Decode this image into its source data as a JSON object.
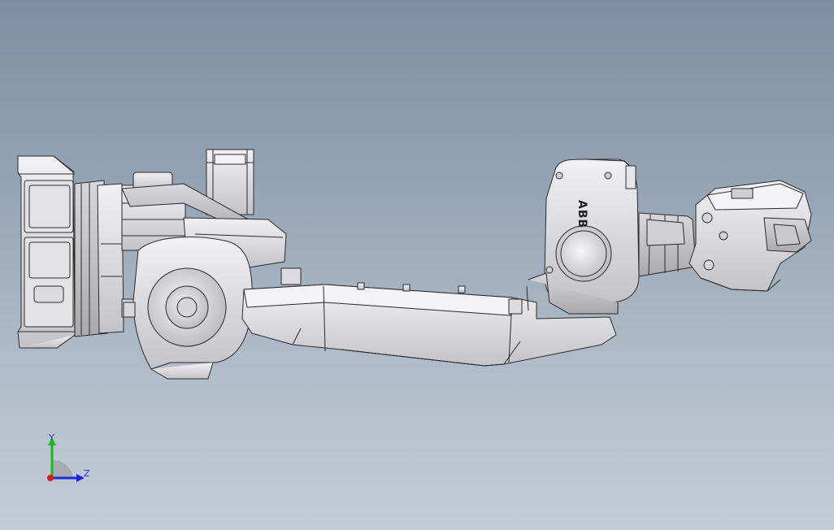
{
  "model": {
    "brand_text": "ABB",
    "colors": {
      "background_top": "#7e8fa3",
      "background_bottom": "#c4ccd6",
      "part_fill": "#e6e6e9",
      "part_shade": "#bdbdc2",
      "edge": "#2b2b2b"
    }
  },
  "triad": {
    "y_label": "Y",
    "z_label": "Z",
    "colors": {
      "y": "#1fb61f",
      "z": "#1c2bd6",
      "origin": "#d81c1c"
    }
  }
}
